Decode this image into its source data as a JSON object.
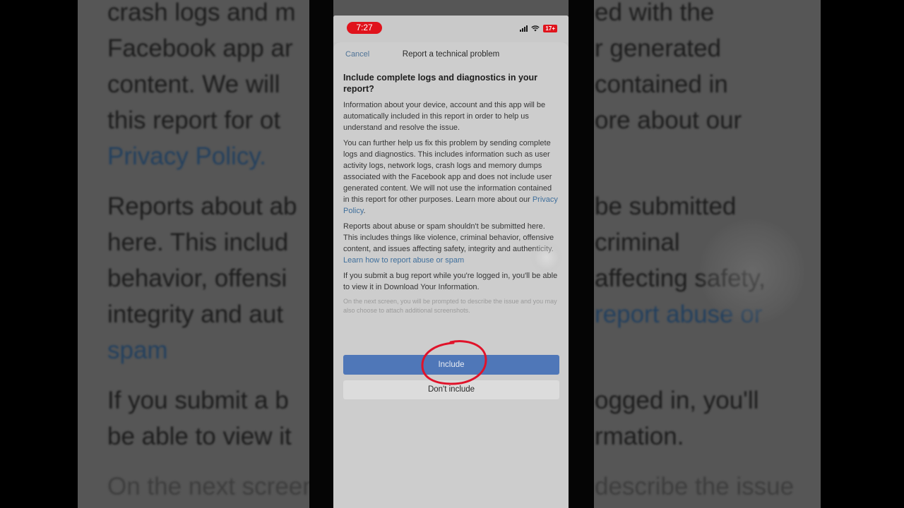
{
  "status_bar": {
    "time": "7:27",
    "battery": "17+",
    "signal_icon": "cellular-signal-icon",
    "wifi_icon": "wifi-icon"
  },
  "nav": {
    "cancel_label": "Cancel",
    "title": "Report a technical problem"
  },
  "dialog": {
    "heading": "Include complete logs and diagnostics in your report?",
    "para1": "Information about your device, account and this app will be automatically included in this report in order to help us understand and resolve the issue.",
    "para2": "You can further help us fix this problem by sending complete logs and diagnostics. This includes information such as user activity logs, network logs, crash logs and memory dumps associated with the Facebook app and does not include user generated content. We will not use the information contained in this report for other purposes. Learn more about our",
    "privacy_link": "Privacy Policy",
    "para3": "Reports about abuse or spam shouldn't be submitted here. This includes things like violence, criminal behavior, offensive content, and issues affecting safety, integrity and authenticity.",
    "abuse_link": "Learn how to report abuse or spam",
    "para4": "If you submit a bug report while you're logged in, you'll be able to view it in Download Your Information.",
    "fine_print": "On the next screen, you will be prompted to describe the issue and you may also choose to attach additional screenshots.",
    "include_label": "Include",
    "dont_include_label": "Don't include"
  },
  "backdrop": {
    "line1": "crash logs and m",
    "line1b": "ed with the",
    "line2": "Facebook app ar",
    "line2b": "r generated",
    "line3": "content. We will",
    "line3b": "contained in",
    "line4": "this report for ot",
    "line4b": "ore about our",
    "line5": "Privacy Policy.",
    "line6": "Reports about ab",
    "line6b": "be submitted",
    "line7": "here. This includ",
    "line7b": "criminal",
    "line8": "behavior, offensi",
    "line8b": "affecting safety,",
    "line9": "integrity and aut",
    "line9b": "report abuse or",
    "line10": "spam",
    "line11": "If you submit a b",
    "line11b": "ogged in, you'll",
    "line12": "be able to view it",
    "line12b": "rmation.",
    "line13": "On the next screen",
    "line13b": "describe the issue"
  },
  "colors": {
    "include_button": "#4f77b8",
    "link": "#3f6f9c",
    "annotation_circle": "#e0132a",
    "time_pill": "#e0131c"
  }
}
